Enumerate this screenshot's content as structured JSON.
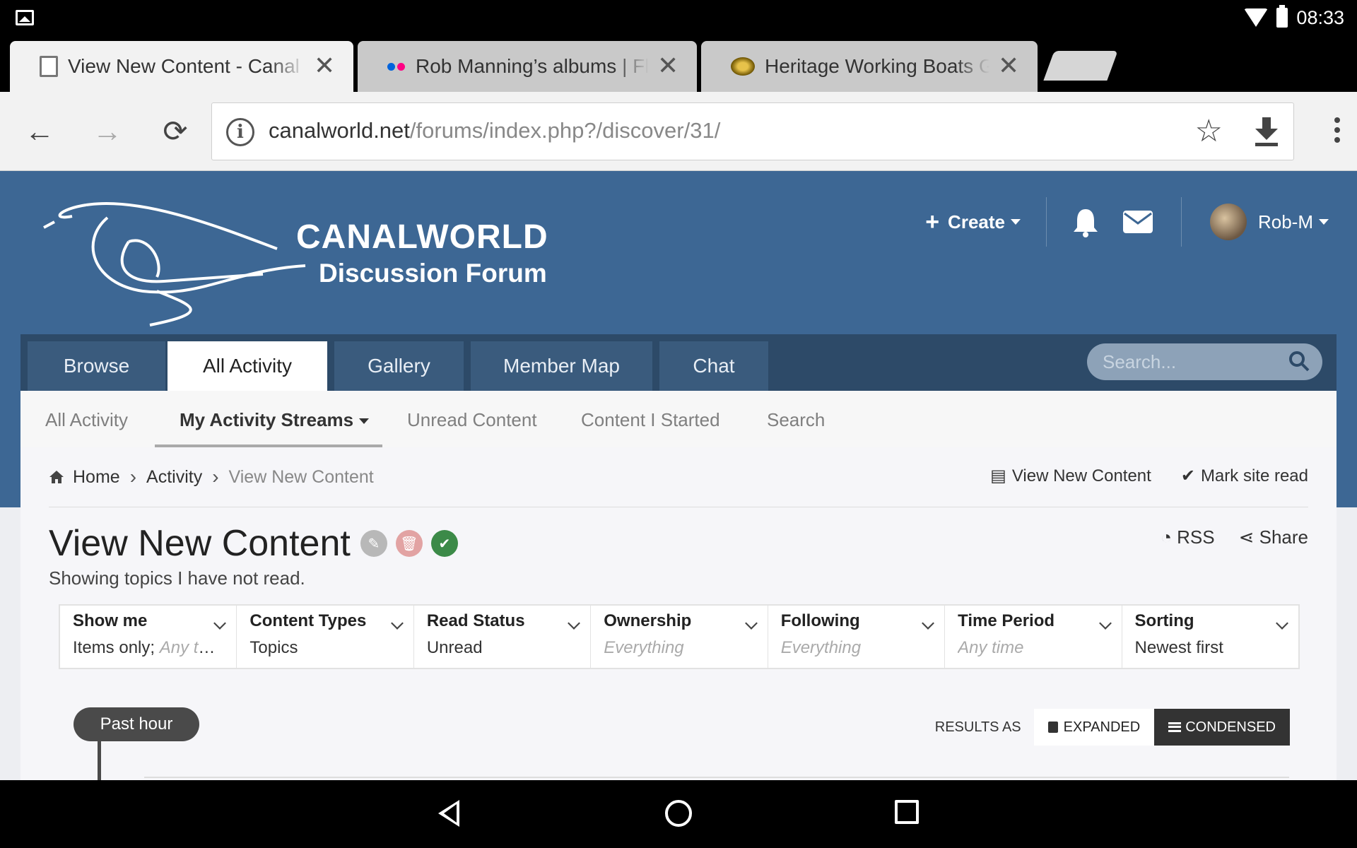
{
  "status_bar": {
    "time": "08:33"
  },
  "browser": {
    "tabs": [
      {
        "title": "View New Content - Canal World Discussion Forum",
        "close": "✕",
        "icon": "document-icon"
      },
      {
        "title": "Rob Manning’s albums | Flickr",
        "close": "✕",
        "icon": "flickr-icon"
      },
      {
        "title": "Heritage Working Boats Group",
        "close": "✕",
        "icon": "heritage-boats-icon"
      }
    ],
    "url_host": "canalworld.net",
    "url_path": "/forums/index.php?/discover/31/"
  },
  "site": {
    "logo_line1": "CANALWORLD",
    "logo_line2": "Discussion Forum",
    "create_label": "Create",
    "username": "Rob-M"
  },
  "main_nav": {
    "tabs": [
      "Browse",
      "All Activity",
      "Gallery",
      "Member Map",
      "Chat"
    ],
    "active": "All Activity",
    "search_placeholder": "Search..."
  },
  "sub_nav": {
    "items": [
      "All Activity",
      "My Activity Streams",
      "Unread Content",
      "Content I Started",
      "Search"
    ],
    "active": "My Activity Streams"
  },
  "breadcrumb": {
    "items": [
      "Home",
      "Activity",
      "View New Content"
    ],
    "right": {
      "view_new": "View New Content",
      "mark_read": "Mark site read"
    }
  },
  "page": {
    "title": "View New Content",
    "subtitle": "Showing topics I have not read.",
    "rss": "RSS",
    "share": "Share"
  },
  "filters": [
    {
      "label": "Show me",
      "value": "Items only;",
      "value_muted": "Any tags"
    },
    {
      "label": "Content Types",
      "value": "Topics"
    },
    {
      "label": "Read Status",
      "value": "Unread"
    },
    {
      "label": "Ownership",
      "value_muted": "Everything"
    },
    {
      "label": "Following",
      "value_muted": "Everything"
    },
    {
      "label": "Time Period",
      "value_muted": "Any time"
    },
    {
      "label": "Sorting",
      "value": "Newest first"
    }
  ],
  "results": {
    "label": "RESULTS AS",
    "expanded": "EXPANDED",
    "condensed": "CONDENSED",
    "selected": "CONDENSED"
  },
  "timeline": {
    "marker": "Past hour"
  },
  "colors": {
    "hero": "#3d6794",
    "nav": "#2d4a68",
    "nav_tab": "#3a5b7d",
    "success": "#3c8a48"
  }
}
